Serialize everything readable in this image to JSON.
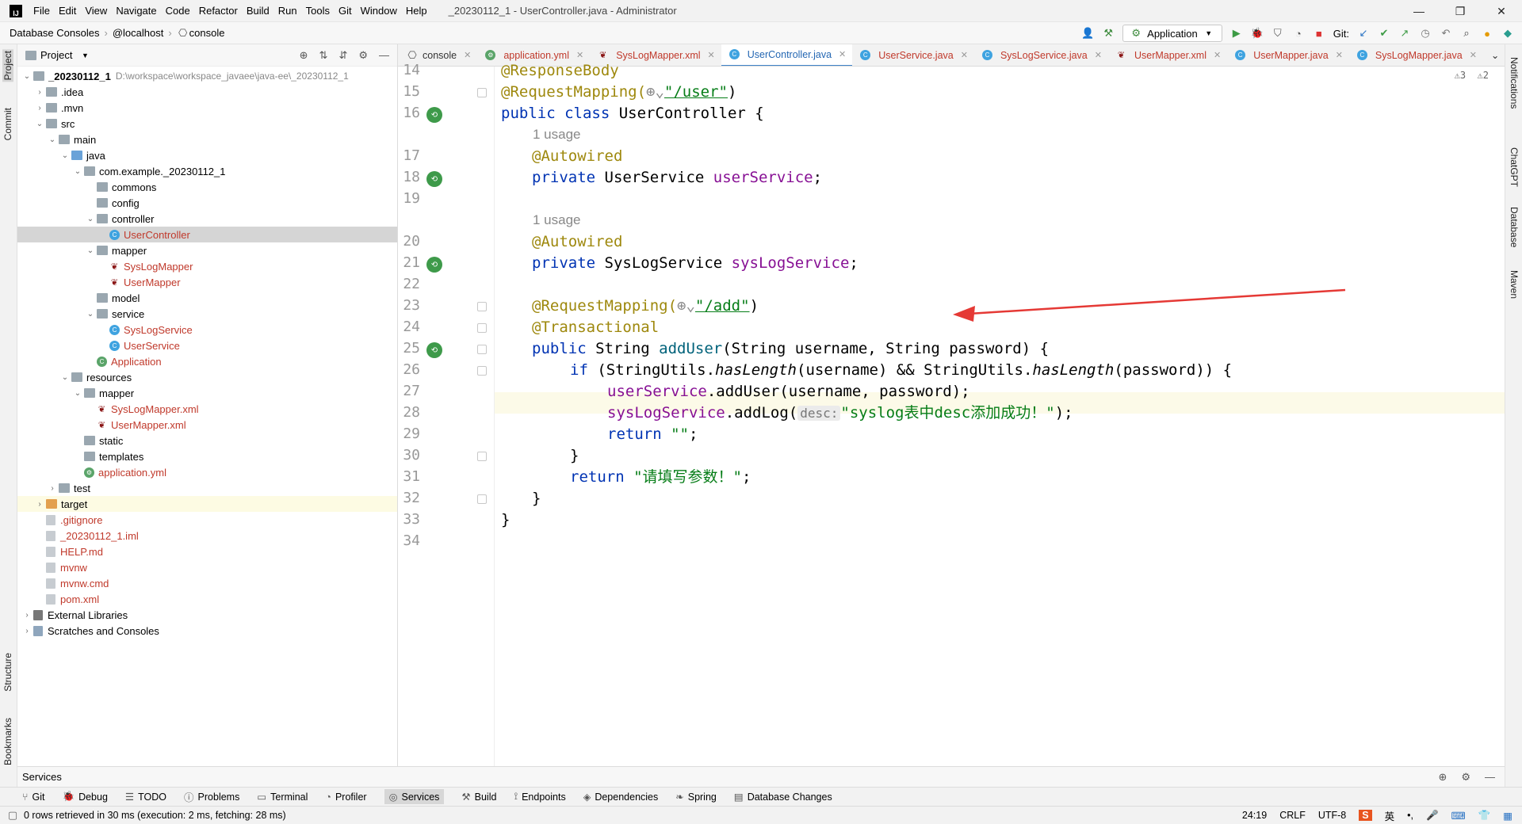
{
  "title_bar": {
    "menus": [
      "File",
      "Edit",
      "View",
      "Navigate",
      "Code",
      "Refactor",
      "Build",
      "Run",
      "Tools",
      "Git",
      "Window",
      "Help"
    ],
    "window_title": "_20230112_1 - UserController.java - Administrator"
  },
  "nav_bar": {
    "breadcrumbs": [
      "Database Consoles",
      "@localhost",
      "console"
    ],
    "run_config": "Application",
    "git_label": "Git:"
  },
  "left_strip": {
    "project": "Project",
    "commit": "Commit",
    "structure": "Structure",
    "bookmarks": "Bookmarks"
  },
  "right_strip": {
    "notifications": "Notifications",
    "chatgpt": "ChatGPT",
    "database": "Database",
    "maven": "Maven"
  },
  "project_panel": {
    "title": "Project",
    "tree": [
      {
        "label": "_20230112_1",
        "extra": "D:\\workspace\\workspace_javaee\\java-ee\\_20230112_1",
        "level": 0,
        "type": "folder",
        "expanded": true,
        "bold": true
      },
      {
        "label": ".idea",
        "level": 1,
        "type": "folder",
        "expanded": false
      },
      {
        "label": ".mvn",
        "level": 1,
        "type": "folder",
        "expanded": false
      },
      {
        "label": "src",
        "level": 1,
        "type": "folder",
        "expanded": true
      },
      {
        "label": "main",
        "level": 2,
        "type": "folder",
        "expanded": true
      },
      {
        "label": "java",
        "level": 3,
        "type": "folder-blue",
        "expanded": true
      },
      {
        "label": "com.example._20230112_1",
        "level": 4,
        "type": "folder",
        "expanded": true
      },
      {
        "label": "commons",
        "level": 5,
        "type": "folder",
        "leaf": true
      },
      {
        "label": "config",
        "level": 5,
        "type": "folder",
        "leaf": true
      },
      {
        "label": "controller",
        "level": 5,
        "type": "folder",
        "expanded": true
      },
      {
        "label": "UserController",
        "level": 6,
        "type": "class",
        "color": "red",
        "selected": true
      },
      {
        "label": "mapper",
        "level": 5,
        "type": "folder",
        "expanded": true
      },
      {
        "label": "SysLogMapper",
        "level": 6,
        "type": "mapper",
        "color": "red"
      },
      {
        "label": "UserMapper",
        "level": 6,
        "type": "mapper",
        "color": "red"
      },
      {
        "label": "model",
        "level": 5,
        "type": "folder",
        "leaf": true
      },
      {
        "label": "service",
        "level": 5,
        "type": "folder",
        "expanded": true
      },
      {
        "label": "SysLogService",
        "level": 6,
        "type": "class",
        "color": "red"
      },
      {
        "label": "UserService",
        "level": 6,
        "type": "class",
        "color": "red"
      },
      {
        "label": "Application",
        "level": 5,
        "type": "app",
        "color": "red",
        "leaf": true
      },
      {
        "label": "resources",
        "level": 3,
        "type": "folder",
        "expanded": true
      },
      {
        "label": "mapper",
        "level": 4,
        "type": "folder",
        "expanded": true
      },
      {
        "label": "SysLogMapper.xml",
        "level": 5,
        "type": "mapper",
        "color": "red",
        "leaf": true
      },
      {
        "label": "UserMapper.xml",
        "level": 5,
        "type": "mapper",
        "color": "red",
        "leaf": true
      },
      {
        "label": "static",
        "level": 4,
        "type": "folder",
        "leaf": true
      },
      {
        "label": "templates",
        "level": 4,
        "type": "folder",
        "leaf": true
      },
      {
        "label": "application.yml",
        "level": 4,
        "type": "yml",
        "color": "red",
        "leaf": true
      },
      {
        "label": "test",
        "level": 2,
        "type": "folder",
        "expanded": false
      },
      {
        "label": "target",
        "level": 1,
        "type": "folder-orange",
        "expanded": false,
        "highlight": true
      },
      {
        "label": ".gitignore",
        "level": 1,
        "type": "file",
        "color": "red",
        "leaf": true
      },
      {
        "label": "_20230112_1.iml",
        "level": 1,
        "type": "file",
        "color": "red",
        "leaf": true
      },
      {
        "label": "HELP.md",
        "level": 1,
        "type": "file",
        "color": "red",
        "leaf": true
      },
      {
        "label": "mvnw",
        "level": 1,
        "type": "file",
        "color": "red",
        "leaf": true
      },
      {
        "label": "mvnw.cmd",
        "level": 1,
        "type": "file",
        "color": "red",
        "leaf": true
      },
      {
        "label": "pom.xml",
        "level": 1,
        "type": "file",
        "color": "red",
        "leaf": true
      },
      {
        "label": "External Libraries",
        "level": 0,
        "type": "lib",
        "expanded": false
      },
      {
        "label": "Scratches and Consoles",
        "level": 0,
        "type": "scratch",
        "expanded": false
      }
    ]
  },
  "editor": {
    "tabs": [
      {
        "label": "console",
        "color": "#333"
      },
      {
        "label": "application.yml",
        "color": "#c0392b"
      },
      {
        "label": "SysLogMapper.xml",
        "color": "#c0392b"
      },
      {
        "label": "UserController.java",
        "color": "#c0392b",
        "active": true
      },
      {
        "label": "UserService.java",
        "color": "#c0392b"
      },
      {
        "label": "SysLogService.java",
        "color": "#c0392b"
      },
      {
        "label": "UserMapper.xml",
        "color": "#c0392b"
      },
      {
        "label": "UserMapper.java",
        "color": "#c0392b"
      },
      {
        "label": "SysLogMapper.java",
        "color": "#c0392b"
      }
    ],
    "warnings": "⚠3  ⚠2",
    "line_numbers": [
      "14",
      "15",
      "16",
      "17",
      "18",
      "19",
      "20",
      "21",
      "22",
      "23",
      "24",
      "25",
      "26",
      "27",
      "28",
      "29",
      "30",
      "31",
      "32",
      "33",
      "34"
    ],
    "code": {
      "l14": "@ResponseBody",
      "l15a": "@RequestMapping(",
      "l15b": "\"/user\"",
      "l15c": ")",
      "l16a": "public class ",
      "l16b": "UserController {",
      "hint1": "1 usage",
      "l17": "@Autowired",
      "l18a": "private ",
      "l18b": "UserService ",
      "l18c": "userService",
      "l18d": ";",
      "hint2": "1 usage",
      "l20": "@Autowired",
      "l21a": "private ",
      "l21b": "SysLogService ",
      "l21c": "sysLogService",
      "l21d": ";",
      "l23a": "@RequestMapping(",
      "l23b": "\"/add\"",
      "l23c": ")",
      "l24": "@Transactional",
      "l25a": "public ",
      "l25b": "String ",
      "l25c": "addUser",
      "l25d": "(String username, String password) {",
      "l26a": "if ",
      "l26b": "(StringUtils.",
      "l26c": "hasLength",
      "l26d": "(username) && StringUtils.",
      "l26e": "hasLength",
      "l26f": "(password)) {",
      "l27a": "userService",
      "l27b": ".addUser(username, password);",
      "l28a": "sysLogService",
      "l28b": ".addLog(",
      "l28hint": "desc:",
      "l28c": "\"syslog表中desc添加成功！\"",
      "l28d": ");",
      "l29a": "return ",
      "l29b": "\"\"",
      "l29c": ";",
      "l30": "}",
      "l31a": "return ",
      "l31b": "\"请填写参数！\"",
      "l31c": ";",
      "l32": "}",
      "l33": "}"
    }
  },
  "services_bar": {
    "label": "Services"
  },
  "tool_windows": [
    "Git",
    "Debug",
    "TODO",
    "Problems",
    "Terminal",
    "Profiler",
    "Services",
    "Build",
    "Endpoints",
    "Dependencies",
    "Spring",
    "Database Changes"
  ],
  "status_bar": {
    "message": "0 rows retrieved in 30 ms (execution: 2 ms, fetching: 28 ms)",
    "position": "24:19",
    "line_sep": "CRLF",
    "encoding": "UTF-8"
  },
  "colors": {
    "accent": "#4083c9",
    "annotation": "#9e880d",
    "keyword": "#0033b3",
    "string": "#067d17",
    "arrow": "#e53935"
  }
}
